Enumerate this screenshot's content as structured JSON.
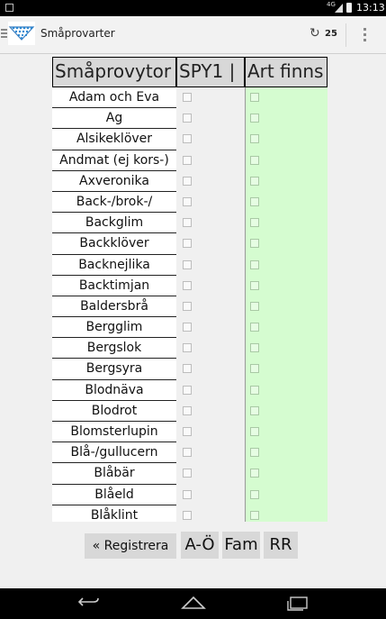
{
  "status_bar": {
    "time": "13:13",
    "network": "4G",
    "colors": {
      "background": "#000000"
    }
  },
  "action_bar": {
    "title": "Småprovarter",
    "sync_count": "25",
    "icons": [
      "menu-icon",
      "app-logo",
      "sync-icon",
      "overflow-menu-icon"
    ]
  },
  "table": {
    "headers": [
      "Småprovytor",
      "SPY1 |",
      "Art finns"
    ],
    "rows": [
      "Adam och Eva",
      "Ag",
      "Alsikeklöver",
      "Andmat (ej kors-)",
      "Axveronika",
      "Back-/brok-/",
      "Backglim",
      "Backklöver",
      "Backnejlika",
      "Backtimjan",
      "Baldersbrå",
      "Bergglim",
      "Bergslok",
      "Bergsyra",
      "Blodnäva",
      "Blodrot",
      "Blomsterlupin",
      "Blå-/gullucern",
      "Blåbär",
      "Blåeld",
      "Blåklint"
    ],
    "colors": {
      "art_finns_column": "#d5fcd0",
      "header": "#d8d8d8"
    }
  },
  "buttons": {
    "register": "« Registrera",
    "ao": "A-Ö",
    "fam": "Fam",
    "rr": "RR"
  },
  "nav_bar": {
    "icons": [
      "back-icon",
      "home-icon",
      "recent-apps-icon"
    ]
  }
}
